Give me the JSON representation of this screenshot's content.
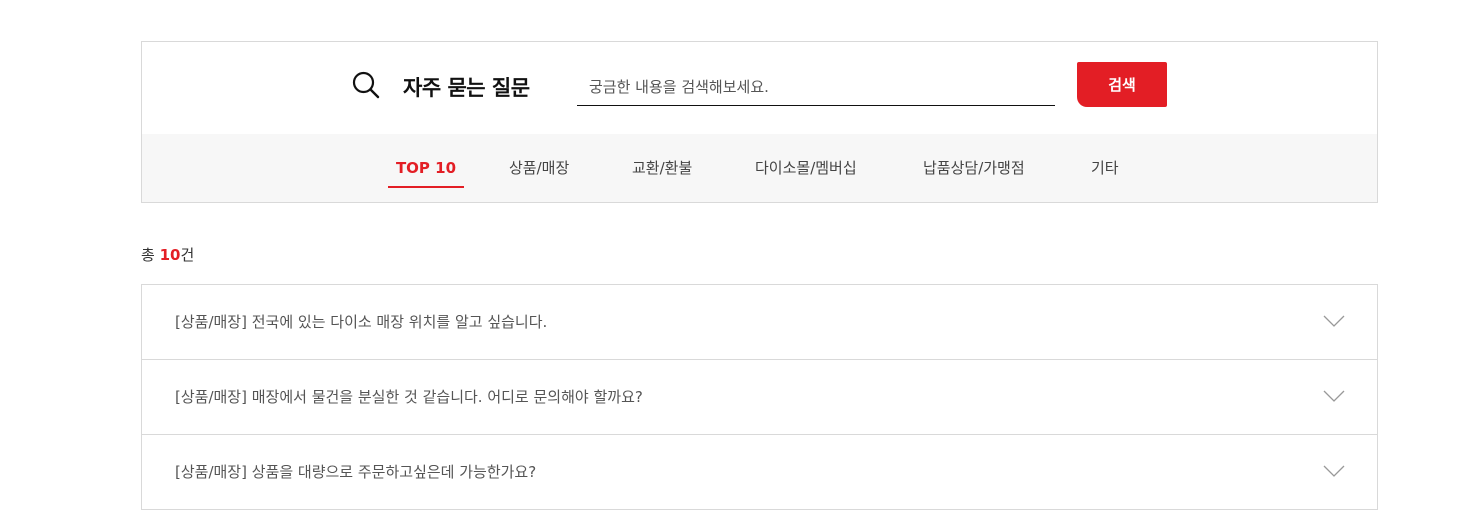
{
  "search": {
    "title": "자주 묻는 질문",
    "placeholder": "궁금한 내용을 검색해보세요.",
    "value": "",
    "button_label": "검색",
    "icon": "search-icon"
  },
  "tabs": [
    {
      "label": "TOP 10",
      "active": true
    },
    {
      "label": "상품/매장",
      "active": false
    },
    {
      "label": "교환/환불",
      "active": false
    },
    {
      "label": "다이소몰/멤버십",
      "active": false
    },
    {
      "label": "납품상담/가맹점",
      "active": false
    },
    {
      "label": "기타",
      "active": false
    }
  ],
  "total": {
    "prefix": "총 ",
    "count": "10",
    "suffix": "건"
  },
  "faq": [
    {
      "question": "[상품/매장] 전국에 있는 다이소 매장 위치를 알고 싶습니다.",
      "icon": "chevron-down-icon"
    },
    {
      "question": "[상품/매장] 매장에서 물건을 분실한 것 같습니다. 어디로 문의해야 할까요?",
      "icon": "chevron-down-icon"
    },
    {
      "question": "[상품/매장] 상품을 대량으로 주문하고싶은데 가능한가요?",
      "icon": "chevron-down-icon"
    }
  ],
  "colors": {
    "accent": "#e31e25",
    "tab_background": "#f7f7f7",
    "border": "#d9d9d9"
  }
}
